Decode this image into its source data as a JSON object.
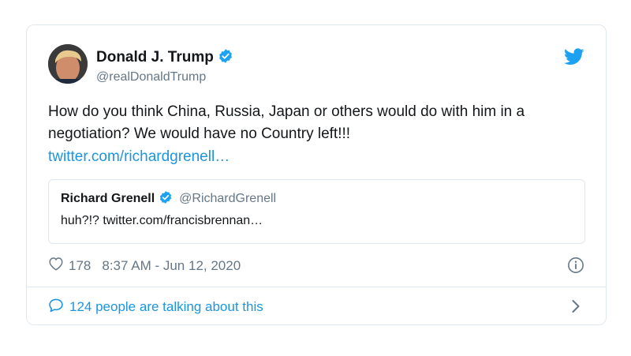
{
  "tweet": {
    "author_name": "Donald J. Trump",
    "handle": "@realDonaldTrump",
    "verified": true,
    "text": "How do you think China, Russia, Japan or others would do with him in a negotiation? We would have no Country left!!!",
    "link_text": "twitter.com/richardgrenell…",
    "likes": "178",
    "timestamp": "8:37 AM - Jun 12, 2020",
    "talking_text": "124 people are talking about this"
  },
  "quote": {
    "author_name": "Richard Grenell",
    "handle": "@RichardGrenell",
    "verified": true,
    "text": "huh?!? twitter.com/francisbrennan…"
  },
  "colors": {
    "link": "#1b95e0",
    "verified": "#1da1f2",
    "border": "#e1e8ed",
    "muted": "#657786",
    "text": "#14171a"
  },
  "icons": [
    "twitter-bird-icon",
    "verified-badge-icon",
    "heart-icon",
    "info-icon",
    "speech-bubble-icon",
    "chevron-right-icon"
  ]
}
